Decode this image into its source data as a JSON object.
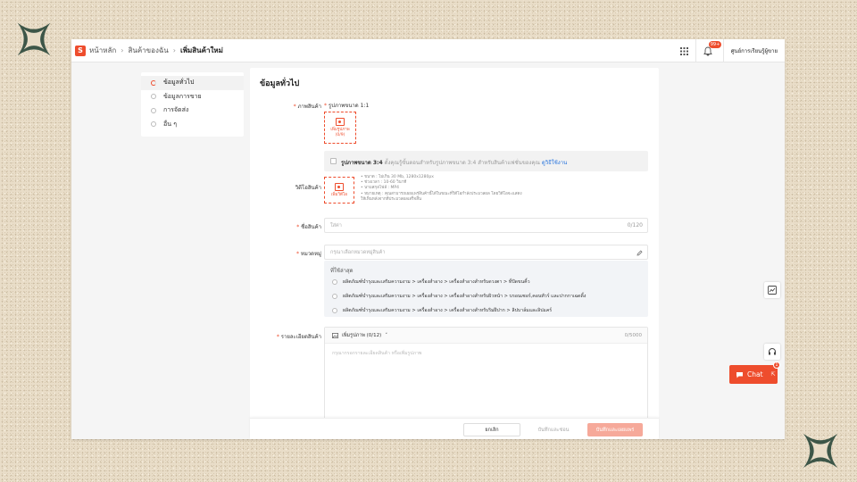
{
  "header": {
    "logo": "S",
    "breadcrumb": [
      "หน้าหลัก",
      "สินค้าของฉัน",
      "เพิ่มสินค้าใหม่"
    ],
    "notification_count": "99+",
    "seller_center": "ศูนย์การเรียนรู้ผู้ขาย"
  },
  "sidenav": {
    "items": [
      {
        "label": "ข้อมูลทั่วไป"
      },
      {
        "label": "ข้อมูลการขาย"
      },
      {
        "label": "การจัดส่ง"
      },
      {
        "label": "อื่น ๆ"
      }
    ]
  },
  "form": {
    "title": "ข้อมูลทั่วไป",
    "product_image": {
      "label": "ภาพสินค้า",
      "ratio_title": "รูปภาพขนาด 1:1",
      "upload_label": "เพิ่มรูปภาพ",
      "upload_count": "(0/9)"
    },
    "ratio34": {
      "title": "รูปภาพขนาด 3:4",
      "desc": "ตั้งคุณรู้ขั้นตอนสำหรับรูปภาพขนาด 3:4 สำหรับสินค้าแฟชั่นของคุณ",
      "link": "ดูวิธีใช้งาน"
    },
    "video": {
      "label": "วิดีโอสินค้า",
      "upload_label": "เพิ่มวิดีโอ",
      "rules": [
        "• ขนาด : ไม่เกิน 30 Mb, 1280x1280px",
        "• ช่วงเวลา : 10-60 วินาที",
        "• นามสกุลไฟล์ : MP4",
        "• หมายเหตุ : คุณสามารถเผยแพร่สินค้านี้ได้ในขณะที่วิดีโอกำลังประมวลผล โดยวิดีโอจะแสดง",
        "  ให้เห็นหลังจากที่ประมวลผลเสร็จสิ้น"
      ]
    },
    "product_name": {
      "label": "ชื่อสินค้า",
      "placeholder": "ใส่ค่า",
      "counter": "0/120"
    },
    "category": {
      "label": "หมวดหมู่",
      "placeholder": "กรุณาเลือกหมวดหมู่สินค้า",
      "recent_title": "ที่ใช้ล่าสุด",
      "recent": [
        "ผลิตภัณฑ์บำรุงและเสริมความงาม > เครื่องสำอาง > เครื่องสำอางสำหรับดวงตา > ที่ปัดขนคิ้ว",
        "ผลิตภัณฑ์บำรุงและเสริมความงาม > เครื่องสำอาง > เครื่องสำอางสำหรับผิวหน้า > บรอนเซอร์,คอนทัวร์ และปากกาเฉดดิ้ง",
        "ผลิตภัณฑ์บำรุงและเสริมความงาม > เครื่องสำอาง > เครื่องสำอางสำหรับริมฝีปาก > ลิปบาล์มและลิปแคร์"
      ]
    },
    "description": {
      "label": "รายละเอียดสินค้า",
      "add_image": "เพิ่มรูปภาพ (0/12)",
      "counter": "0/5000",
      "placeholder": "กรุณากรอกรายละเอียดสินค้า หรือเพิ่มรูปภาพ"
    }
  },
  "footer": {
    "cancel": "ยกเลิก",
    "save_hide": "บันทึกและซ่อน",
    "save_publish": "บันทึกและเผยแพร่"
  },
  "chat": {
    "label": "Chat",
    "badge": "1"
  },
  "colors": {
    "brand": "#ee4d2d",
    "background": "#e9ddc8",
    "star": "#3d5648"
  }
}
